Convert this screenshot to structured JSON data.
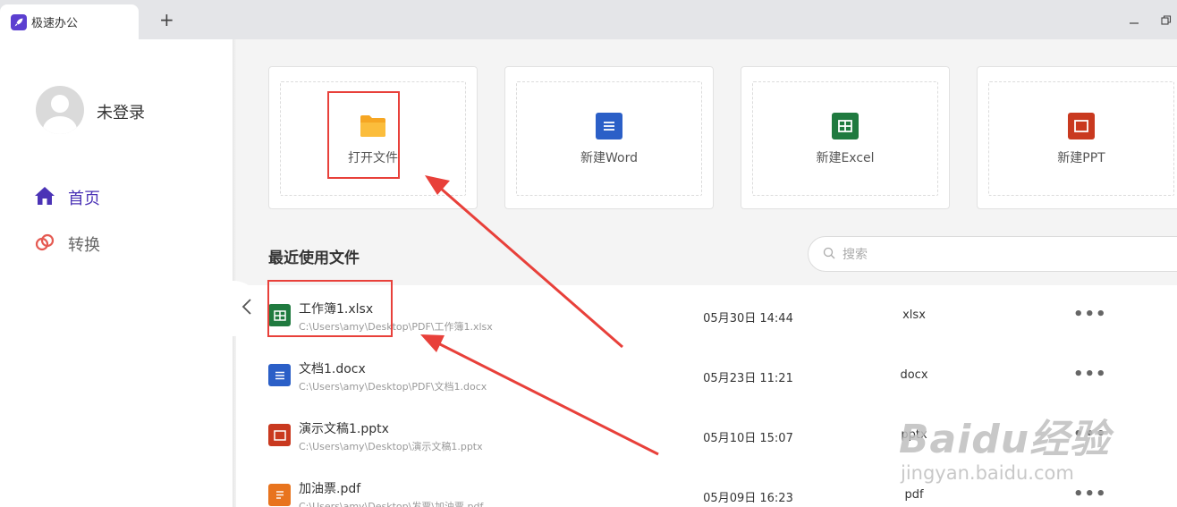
{
  "tab": {
    "title": "极速办公",
    "add": "+"
  },
  "window": {
    "minimize": "—",
    "restore": "❐"
  },
  "user": {
    "name": "未登录"
  },
  "nav": [
    {
      "label": "首页",
      "icon": "home-icon",
      "active": true
    },
    {
      "label": "转换",
      "icon": "convert-icon",
      "active": false
    }
  ],
  "actions": [
    {
      "label": "打开文件",
      "icon": "folder-icon",
      "color": "#f6a623"
    },
    {
      "label": "新建Word",
      "icon": "word-icon",
      "color": "#2b5fc7"
    },
    {
      "label": "新建Excel",
      "icon": "excel-icon",
      "color": "#1f7a3f"
    },
    {
      "label": "新建PPT",
      "icon": "ppt-icon",
      "color": "#c9391f"
    }
  ],
  "recent": {
    "title": "最近使用文件",
    "search_placeholder": "搜索",
    "files": [
      {
        "name": "工作簿1.xlsx",
        "path": "C:\\Users\\amy\\Desktop\\PDF\\工作簿1.xlsx",
        "date": "05月30日 14:44",
        "type": "xlsx",
        "icon": "excel-icon",
        "color": "#1f7a3f",
        "more": "•••"
      },
      {
        "name": "文档1.docx",
        "path": "C:\\Users\\amy\\Desktop\\PDF\\文档1.docx",
        "date": "05月23日 11:21",
        "type": "docx",
        "icon": "word-icon",
        "color": "#2b5fc7",
        "more": "•••"
      },
      {
        "name": "演示文稿1.pptx",
        "path": "C:\\Users\\amy\\Desktop\\演示文稿1.pptx",
        "date": "05月10日 15:07",
        "type": "pptx",
        "icon": "ppt-icon",
        "color": "#c9391f",
        "more": "•••"
      },
      {
        "name": "加油票.pdf",
        "path": "C:\\Users\\amy\\Desktop\\发票\\加油票.pdf",
        "date": "05月09日 16:23",
        "type": "pdf",
        "icon": "pdf-icon",
        "color": "#e8741e",
        "more": "•••"
      }
    ]
  },
  "watermark": {
    "main": "Baidu经验",
    "sub": "jingyan.baidu.com"
  },
  "colors": {
    "accent": "#4b33b6",
    "annotation": "#e8403a"
  }
}
